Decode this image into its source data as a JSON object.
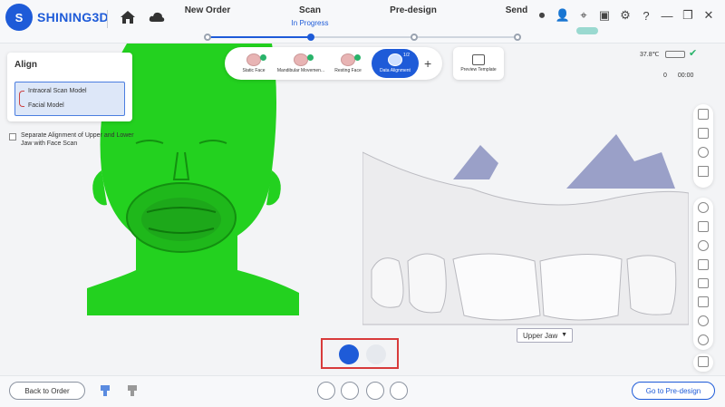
{
  "app": {
    "brand": "SHINING3D",
    "accent": "#1e5bd8"
  },
  "steps": [
    {
      "name": "New Order",
      "sub": ""
    },
    {
      "name": "Scan",
      "sub": "In Progress"
    },
    {
      "name": "Pre-design",
      "sub": ""
    },
    {
      "name": "Send",
      "sub": ""
    }
  ],
  "align_panel": {
    "title": "Align",
    "items": [
      "Intraoral Scan Model",
      "Facial Model"
    ],
    "separate_label": "Separate Alignment of Upper and Lower Jaw with Face Scan"
  },
  "capture_tabs": [
    {
      "label": "Static Face",
      "done": true
    },
    {
      "label": "Mandibular Movemen...",
      "done": true
    },
    {
      "label": "Resting Face",
      "done": true
    },
    {
      "label": "Data Alignment",
      "badge": "1/2",
      "active": true
    }
  ],
  "add_label": "+",
  "preview_label": "Preview Template",
  "status": {
    "temperature": "37.8℃",
    "count_a": "0",
    "count_b": "00:00"
  },
  "jaw_select": "Upper Jaw",
  "footer": {
    "back_label": "Back to Order",
    "next_label": "Go to Pre-design"
  }
}
